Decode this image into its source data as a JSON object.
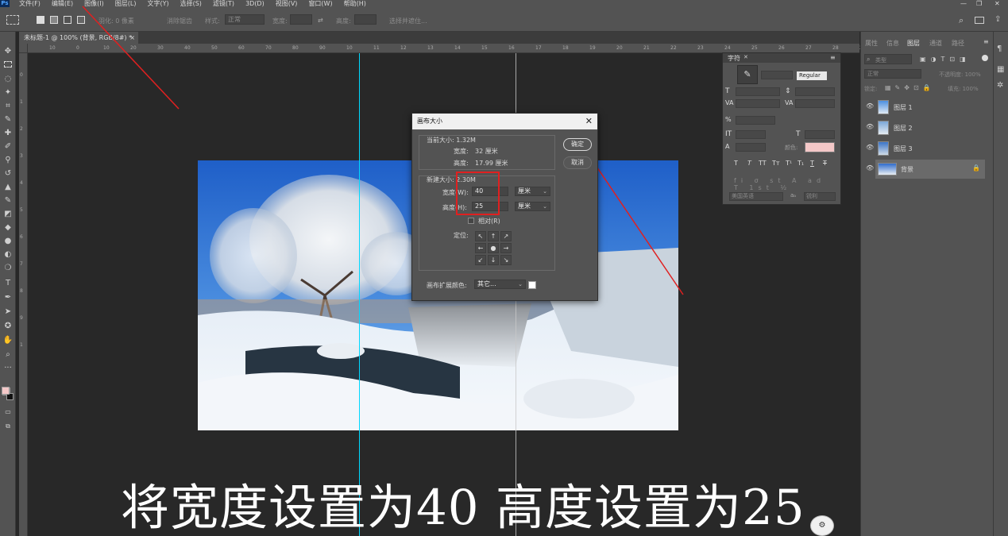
{
  "menubar": {
    "items": [
      "文件(F)",
      "编辑(E)",
      "图像(I)",
      "图层(L)",
      "文字(Y)",
      "选择(S)",
      "滤镜(T)",
      "3D(D)",
      "视图(V)",
      "窗口(W)",
      "帮助(H)"
    ]
  },
  "options": {
    "feather": "羽化: 0 像素",
    "antialias": "消除锯齿",
    "style_label": "样式:",
    "style_value": "正常",
    "width_label": "宽度:",
    "height_label": "高度:",
    "select_mask": "选择并遮住..."
  },
  "document": {
    "tab_title": "未标题-1 @ 100% (背景, RGB/8#) *"
  },
  "rulers": {
    "top": [
      "10",
      "0",
      "10",
      "20",
      "30",
      "40",
      "50",
      "60",
      "70",
      "80",
      "90",
      "10",
      "11",
      "12",
      "13",
      "14",
      "15",
      "16",
      "17",
      "18",
      "19",
      "20",
      "21",
      "22",
      "23",
      "24",
      "25",
      "26",
      "27",
      "28",
      "29"
    ],
    "left": [
      "0",
      "1",
      "2",
      "3",
      "4",
      "5",
      "6",
      "7",
      "8",
      "9",
      "1"
    ]
  },
  "dialog": {
    "title": "画布大小",
    "current_size_label": "当前大小: 1.32M",
    "current_width_label": "宽度:",
    "current_width_value": "32 厘米",
    "current_height_label": "高度:",
    "current_height_value": "17.99 厘米",
    "new_size_label": "新建大小: 2.30M",
    "width_label": "宽度(W):",
    "width_value": "40",
    "height_label": "高度(H):",
    "height_value": "25",
    "unit": "厘米",
    "relative_label": "相对(R)",
    "anchor_label": "定位:",
    "anchor_arrows": [
      "↖",
      "↑",
      "↗",
      "←",
      "●",
      "→",
      "↙",
      "↓",
      "↘"
    ],
    "ext_color_label": "画布扩展颜色:",
    "ext_color_value": "其它...",
    "ok_label": "确定",
    "cancel_label": "取消"
  },
  "char_panel": {
    "title": "字符",
    "font_style": "Regular",
    "color_label": "颜色:",
    "glyphs": [
      "T",
      "T",
      "TT",
      "Tт",
      "T¹",
      "T₁",
      "T",
      "T"
    ],
    "language": "美国英语",
    "aa": "锐利"
  },
  "layers_panel": {
    "tabs": [
      "属性",
      "信息",
      "图层",
      "通道",
      "路径"
    ],
    "kind_placeholder": "类型",
    "blend_mode": "正常",
    "opacity": "不透明度: 100%",
    "lock_label": "锁定:",
    "fill": "填充: 100%",
    "layers": [
      {
        "name": "图层 1"
      },
      {
        "name": "图层 2"
      },
      {
        "name": "图层 3"
      },
      {
        "name": "背景"
      }
    ]
  },
  "subtitle": "将宽度设置为40 高度设置为25",
  "colors": {
    "fg": "#f4c8c8",
    "guide": "#00d8ff",
    "highlight": "#e02020"
  }
}
